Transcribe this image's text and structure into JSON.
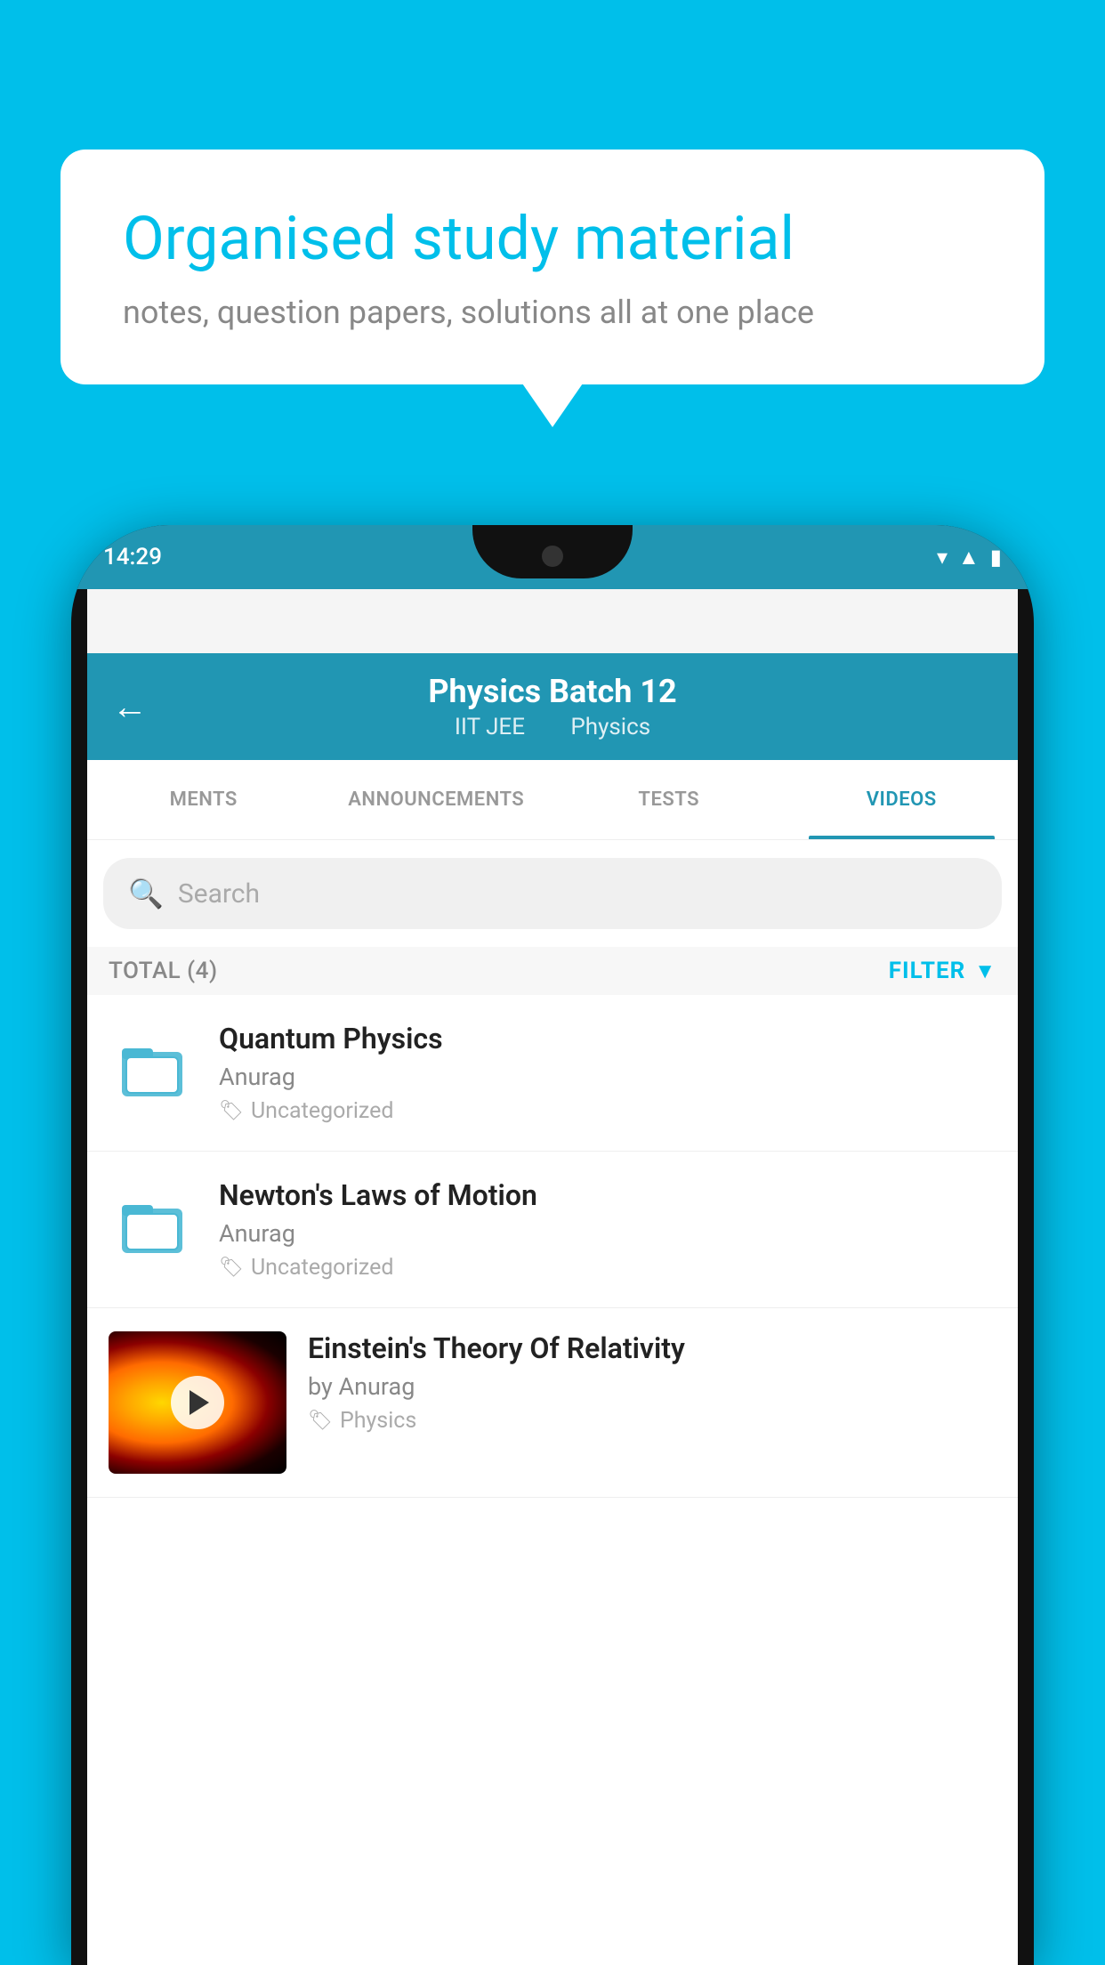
{
  "background_color": "#00BFEA",
  "speech_bubble": {
    "title": "Organised study material",
    "subtitle": "notes, question papers, solutions all at one place"
  },
  "status_bar": {
    "time": "14:29",
    "icons": [
      "▼",
      "◄",
      "▮"
    ]
  },
  "app_bar": {
    "back_icon": "←",
    "title": "Physics Batch 12",
    "subtitle_part1": "IIT JEE",
    "subtitle_part2": "Physics"
  },
  "tabs": [
    {
      "label": "MENTS",
      "active": false
    },
    {
      "label": "ANNOUNCEMENTS",
      "active": false
    },
    {
      "label": "TESTS",
      "active": false
    },
    {
      "label": "VIDEOS",
      "active": true
    }
  ],
  "search": {
    "placeholder": "Search"
  },
  "filter": {
    "total_label": "TOTAL (4)",
    "filter_label": "FILTER"
  },
  "videos": [
    {
      "title": "Quantum Physics",
      "author": "Anurag",
      "tag": "Uncategorized",
      "type": "folder"
    },
    {
      "title": "Newton's Laws of Motion",
      "author": "Anurag",
      "tag": "Uncategorized",
      "type": "folder"
    },
    {
      "title": "Einstein's Theory Of Relativity",
      "author": "by Anurag",
      "tag": "Physics",
      "type": "video"
    }
  ]
}
